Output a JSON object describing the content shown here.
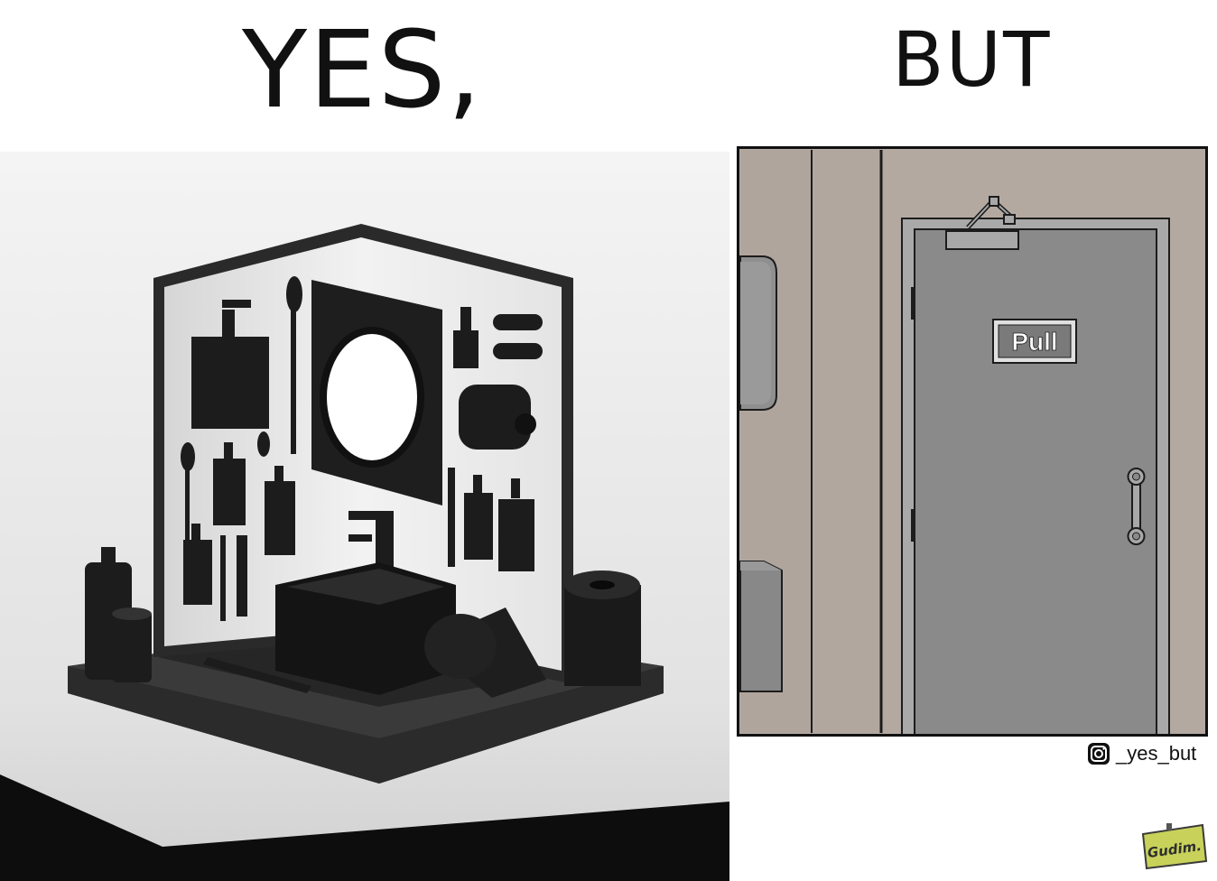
{
  "captions": {
    "left": "YES,",
    "right": "BUT"
  },
  "door": {
    "sign": "Pull"
  },
  "credit": {
    "icon": "instagram-icon",
    "handle": "_yes_but"
  },
  "watermark": {
    "text": "Gudim."
  },
  "colors": {
    "wall": "#b4a9a1",
    "door": "#8a8a8a",
    "dark": "#1c1c1c"
  }
}
